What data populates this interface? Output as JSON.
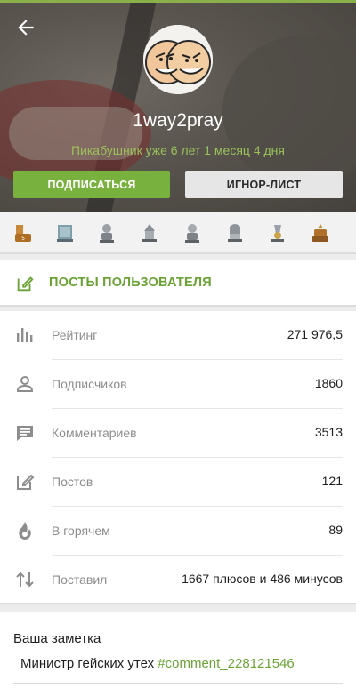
{
  "header": {
    "username": "1way2pray",
    "tenure": "Пикабушник уже 6 лет 1 месяц 4 дня",
    "accent_color": "#79b13e"
  },
  "buttons": {
    "subscribe": "ПОДПИСАТЬСЯ",
    "ignore": "ИГНОР-ЛИСТ"
  },
  "awards": [
    "award-1",
    "award-2",
    "award-3",
    "award-4",
    "award-5",
    "award-6",
    "award-7",
    "award-8"
  ],
  "posts_link": {
    "label": "ПОСТЫ ПОЛЬЗОВАТЕЛЯ"
  },
  "stats": [
    {
      "icon": "bar-chart-icon",
      "label": "Рейтинг",
      "value": "271 976,5"
    },
    {
      "icon": "person-icon",
      "label": "Подписчиков",
      "value": "1860"
    },
    {
      "icon": "comment-icon",
      "label": "Комментариев",
      "value": "3513"
    },
    {
      "icon": "edit-icon",
      "label": "Постов",
      "value": "121"
    },
    {
      "icon": "flame-icon",
      "label": "В горячем",
      "value": "89"
    },
    {
      "icon": "sort-arrows-icon",
      "label": "Поставил",
      "value": "1667 плюсов и 486 минусов"
    }
  ],
  "note": {
    "title": "Ваша заметка",
    "text": "Министр гейских утех",
    "link": "#comment_228121546"
  }
}
